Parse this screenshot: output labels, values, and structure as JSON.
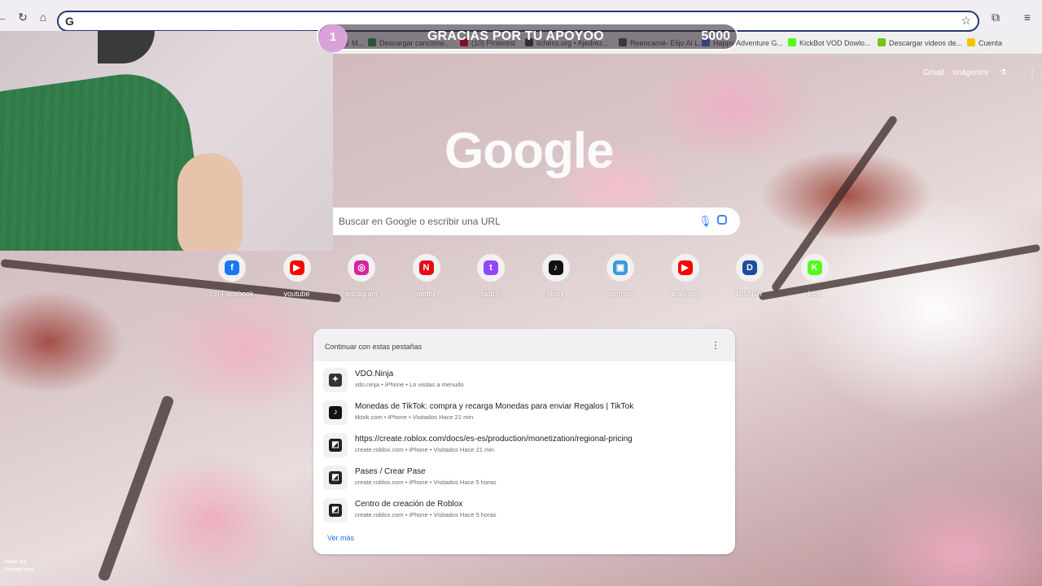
{
  "toolbar": {
    "back_icon": "arrow-left-icon",
    "reload_icon": "reload-icon",
    "home_icon": "home-icon",
    "omnibox_value": "",
    "omnibox_icon": "G"
  },
  "bookmarks": [
    {
      "label": "M...",
      "color": "#9aa0a6"
    },
    {
      "label": "Descargar cancione...",
      "color": "#2e9b4a"
    },
    {
      "label": "(10) Pinterest",
      "color": "#e60023"
    },
    {
      "label": "lichess.org • Ajedrez...",
      "color": "#444444"
    },
    {
      "label": "Reencarné- Elijo Al L...",
      "color": "#555555"
    },
    {
      "label": "Happy Adventure G...",
      "color": "#3d6fe0"
    },
    {
      "label": "KickBot VOD Dowlo...",
      "color": "#53fc18"
    },
    {
      "label": "Descargar videos de...",
      "color": "#7cc30f"
    },
    {
      "label": "Cuenta",
      "color": "#f5c400"
    }
  ],
  "banner": {
    "number": "1",
    "text": "GRACIAS POR TU APOYOO",
    "count": "5000"
  },
  "header_links": {
    "gmail": "Gmail",
    "images": "Imágenes"
  },
  "logo_text": "Google",
  "search": {
    "placeholder": "Buscar en Google o escribir una URL"
  },
  "shortcuts": [
    {
      "label": "(3) Facebook",
      "glyph": "f",
      "color": "#1877f2"
    },
    {
      "label": "youtube",
      "glyph": "▶",
      "color": "#ff0000"
    },
    {
      "label": "instagram",
      "glyph": "◎",
      "color": "#d6249f"
    },
    {
      "label": "netflix",
      "glyph": "N",
      "color": "#e50914"
    },
    {
      "label": "twitch",
      "glyph": "t",
      "color": "#9146ff"
    },
    {
      "label": "tiktok",
      "glyph": "♪",
      "color": "#111111"
    },
    {
      "label": "aternos",
      "glyph": "▣",
      "color": "#3a9ad9"
    },
    {
      "label": "analytycs",
      "glyph": "▶",
      "color": "#ff0000"
    },
    {
      "label": "DISNEY",
      "glyph": "D",
      "color": "#1b4d9b"
    },
    {
      "label": "kick",
      "glyph": "K",
      "color": "#53fc18"
    }
  ],
  "continue": {
    "title": "Continuar con estas pestañas",
    "more": "Ver más",
    "items": [
      {
        "title": "VDO.Ninja",
        "sub": "vdo.ninja • iPhone • Lo visitas a menudo",
        "icon_color": "#333333",
        "glyph": "✦"
      },
      {
        "title": "Monedas de TikTok: compra y recarga Monedas para enviar Regalos | TikTok",
        "sub": "tiktok.com • iPhone • Visitados Hace 21 min",
        "icon_color": "#111111",
        "glyph": "♪"
      },
      {
        "title": "https://create.roblox.com/docs/es-es/production/monetization/regional-pricing",
        "sub": "create.roblox.com • iPhone • Visitados Hace 21 min",
        "icon_color": "#222222",
        "glyph": "◩"
      },
      {
        "title": "Pases / Crear Pase",
        "sub": "create.roblox.com • iPhone • Visitados Hace 5 horas",
        "icon_color": "#222222",
        "glyph": "◩"
      },
      {
        "title": "Centro de creación de Roblox",
        "sub": "create.roblox.com • iPhone • Visitados Hace 5 horas",
        "icon_color": "#222222",
        "glyph": "◩"
      }
    ]
  },
  "credit": {
    "line1": "...eado por",
    "line2": "...themer.com"
  }
}
